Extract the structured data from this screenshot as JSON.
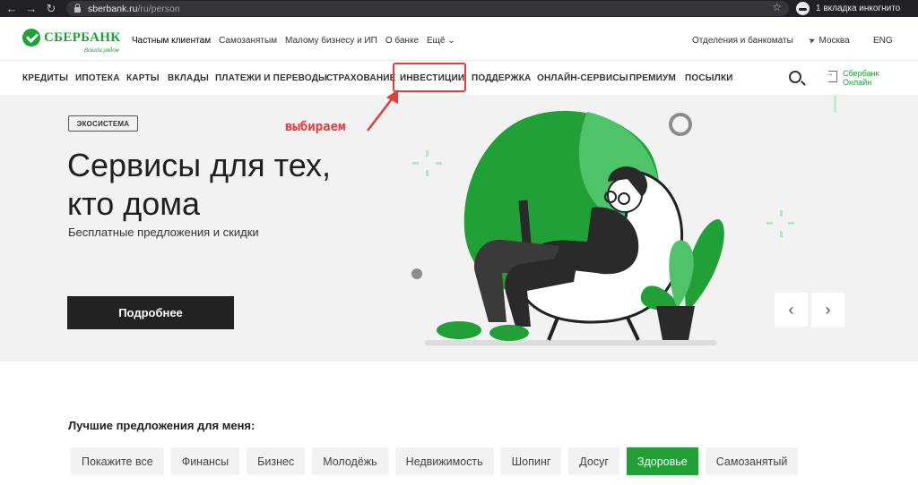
{
  "browser": {
    "url_host": "sberbank.ru",
    "url_path": "/ru/person",
    "incognito_label": "1 вкладка инкогнито"
  },
  "header": {
    "logo_text": "СБЕРБАНК",
    "logo_slogan": "Всегда рядом",
    "top_links": [
      "Частным клиентам",
      "Самозанятым",
      "Малому бизнесу и ИП",
      "О банке",
      "Ещё"
    ],
    "branches": "Отделения и банкоматы",
    "city": "Москва",
    "lang": "ENG"
  },
  "nav": {
    "items": [
      "КРЕДИТЫ",
      "ИПОТЕКА",
      "КАРТЫ",
      "ВКЛАДЫ",
      "ПЛАТЕЖИ И ПЕРЕВОДЫ",
      "СТРАХОВАНИЕ",
      "ИНВЕСТИЦИИ",
      "ПОДДЕРЖКА",
      "ОНЛАЙН-СЕРВИСЫ",
      "ПРЕМИУМ",
      "ПОСЫЛКИ"
    ],
    "sbol_line1": "Сбербанк",
    "sbol_line2": "Онлайн"
  },
  "annotation": {
    "text": "выбираем",
    "color": "#e03d3d"
  },
  "hero": {
    "tag": "ЭКОСИСТЕМА",
    "title_line1": "Сервисы для тех,",
    "title_line2": "кто дома",
    "subtitle": "Бесплатные предложения и скидки",
    "button": "Подробнее",
    "prev_icon": "‹",
    "next_icon": "›"
  },
  "offers": {
    "title": "Лучшие предложения для меня:",
    "chips": [
      "Покажите все",
      "Финансы",
      "Бизнес",
      "Молодёжь",
      "Недвижимость",
      "Шопинг",
      "Досуг",
      "Здоровье",
      "Самозанятый"
    ],
    "active_chip": "Здоровье"
  },
  "colors": {
    "brand_green": "#21a038",
    "hero_bg": "#f2f2f2",
    "dark": "#222222"
  }
}
